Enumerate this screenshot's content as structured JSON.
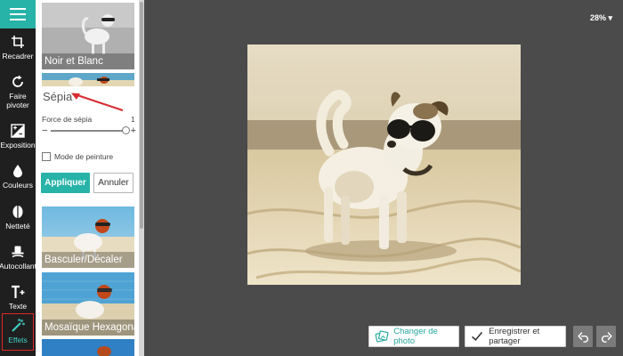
{
  "toolbar": {
    "tools": [
      {
        "label": "Recadrer",
        "icon": "crop-icon"
      },
      {
        "label": "Faire\npivoter",
        "icon": "rotate-icon"
      },
      {
        "label": "Exposition",
        "icon": "exposure-icon"
      },
      {
        "label": "Couleurs",
        "icon": "color-drop-icon"
      },
      {
        "label": "Netteté",
        "icon": "sharpness-icon"
      },
      {
        "label": "Autocollant",
        "icon": "sticker-icon"
      },
      {
        "label": "Texte",
        "icon": "text-icon"
      },
      {
        "label": "Effets",
        "icon": "magic-wand-icon"
      }
    ],
    "active_tool": "Effets"
  },
  "panel": {
    "effects": [
      {
        "label": "Noir et Blanc"
      },
      {
        "label": "Basculer/Décaler"
      },
      {
        "label": "Mosaïque Hexagonal"
      }
    ],
    "selected_effect": {
      "title": "Sépia",
      "slider_label": "Force de sépia",
      "slider_min_symbol": "−",
      "slider_max_symbol": "+",
      "slider_max_value": "1",
      "slider_value_fraction": 0.98,
      "paint_mode_label": "Mode de peinture",
      "paint_mode_checked": false,
      "apply_label": "Appliquer",
      "cancel_label": "Annuler"
    }
  },
  "canvas": {
    "zoom_label": "28% ▾"
  },
  "actions": {
    "change_photo_label": "Changer de photo",
    "save_share_label": "Enregistrer et partager"
  },
  "colors": {
    "accent": "#27b3a8",
    "highlight_border": "#e0262a",
    "sidebar_bg": "#1f1f1f",
    "canvas_bg": "#4b4b4b"
  }
}
